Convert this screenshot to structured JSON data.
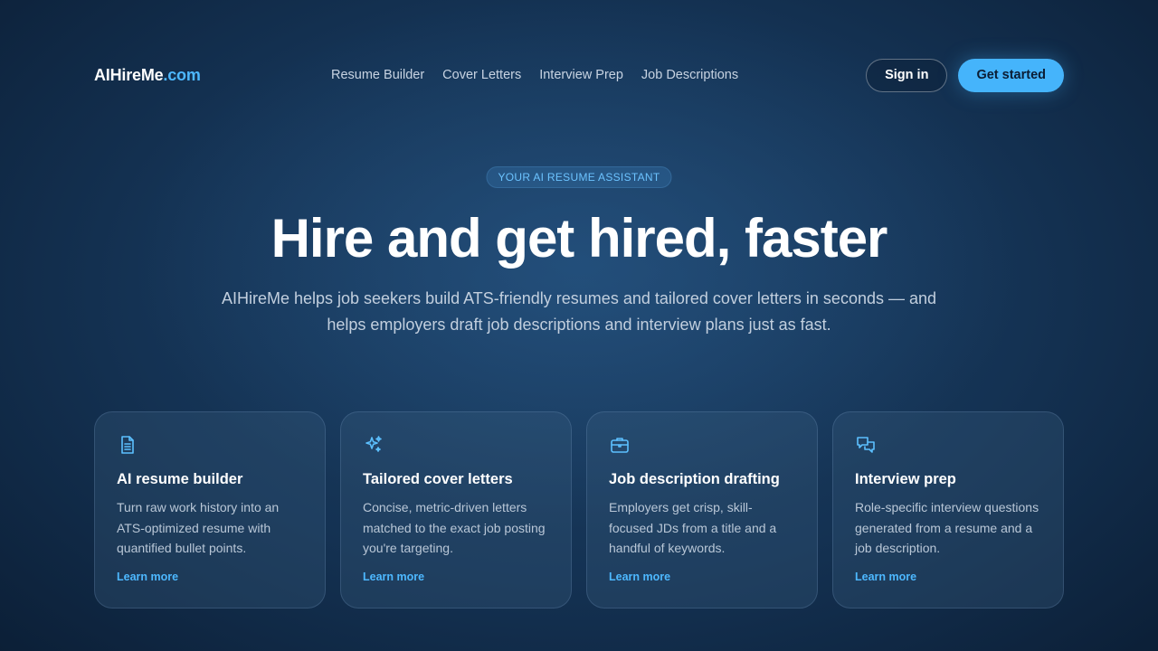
{
  "brand": {
    "name": "AIHireMe",
    "domain": ".com"
  },
  "nav": {
    "links": [
      "Resume Builder",
      "Cover Letters",
      "Interview Prep",
      "Job Descriptions"
    ],
    "signin_label": "Sign in",
    "start_label": "Get started"
  },
  "hero": {
    "eyebrow": "YOUR AI RESUME ASSISTANT",
    "title": "Hire and get hired, faster",
    "subtitle": "AIHireMe helps job seekers build ATS-friendly resumes and tailored cover letters in seconds — and helps employers draft job descriptions and interview plans just as fast."
  },
  "features": [
    {
      "icon": "document-icon",
      "title": "AI resume builder",
      "text": "Turn raw work history into an ATS-optimized resume with quantified bullet points.",
      "link": "Learn more"
    },
    {
      "icon": "sparkles-icon",
      "title": "Tailored cover letters",
      "text": "Concise, metric-driven letters matched to the exact job posting you're targeting.",
      "link": "Learn more"
    },
    {
      "icon": "briefcase-icon",
      "title": "Job description drafting",
      "text": "Employers get crisp, skill-focused JDs from a title and a handful of keywords.",
      "link": "Learn more"
    },
    {
      "icon": "chat-bubbles-icon",
      "title": "Interview prep",
      "text": "Role-specific interview questions generated from a resume and a job description.",
      "link": "Learn more"
    }
  ],
  "colors": {
    "accent": "#45b4fb",
    "link": "#4db8ff",
    "background": "#143253"
  }
}
